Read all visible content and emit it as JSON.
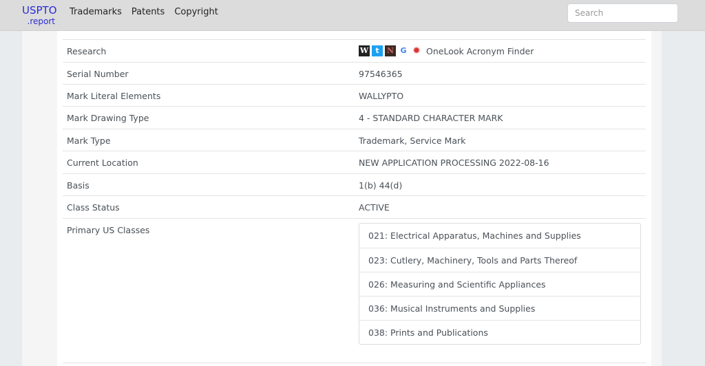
{
  "navbar": {
    "brand_main": "USPTO",
    "brand_sub": ".report",
    "links": [
      "Trademarks",
      "Patents",
      "Copyright"
    ],
    "search_placeholder": "Search"
  },
  "research": {
    "label": "Research",
    "icons": [
      "wikipedia-icon",
      "twitter-icon",
      "notion-icon",
      "google-translate-icon",
      "onelook-icon"
    ],
    "onelook_text": "OneLook Acronym Finder"
  },
  "fields": [
    {
      "label": "Serial Number",
      "value": "97546365"
    },
    {
      "label": "Mark Literal Elements",
      "value": "WALLYPTO"
    },
    {
      "label": "Mark Drawing Type",
      "value": "4 - STANDARD CHARACTER MARK"
    },
    {
      "label": "Mark Type",
      "value": "Trademark, Service Mark"
    },
    {
      "label": "Current Location",
      "value": "NEW APPLICATION PROCESSING 2022-08-16"
    },
    {
      "label": "Basis",
      "value": "1(b) 44(d)"
    },
    {
      "label": "Class Status",
      "value": "ACTIVE"
    }
  ],
  "primary_classes": {
    "label": "Primary US Classes",
    "items": [
      "021: Electrical Apparatus, Machines and Supplies",
      "023: Cutlery, Machinery, Tools and Parts Thereof",
      "026: Measuring and Scientific Appliances",
      "036: Musical Instruments and Supplies",
      "038: Prints and Publications"
    ]
  }
}
